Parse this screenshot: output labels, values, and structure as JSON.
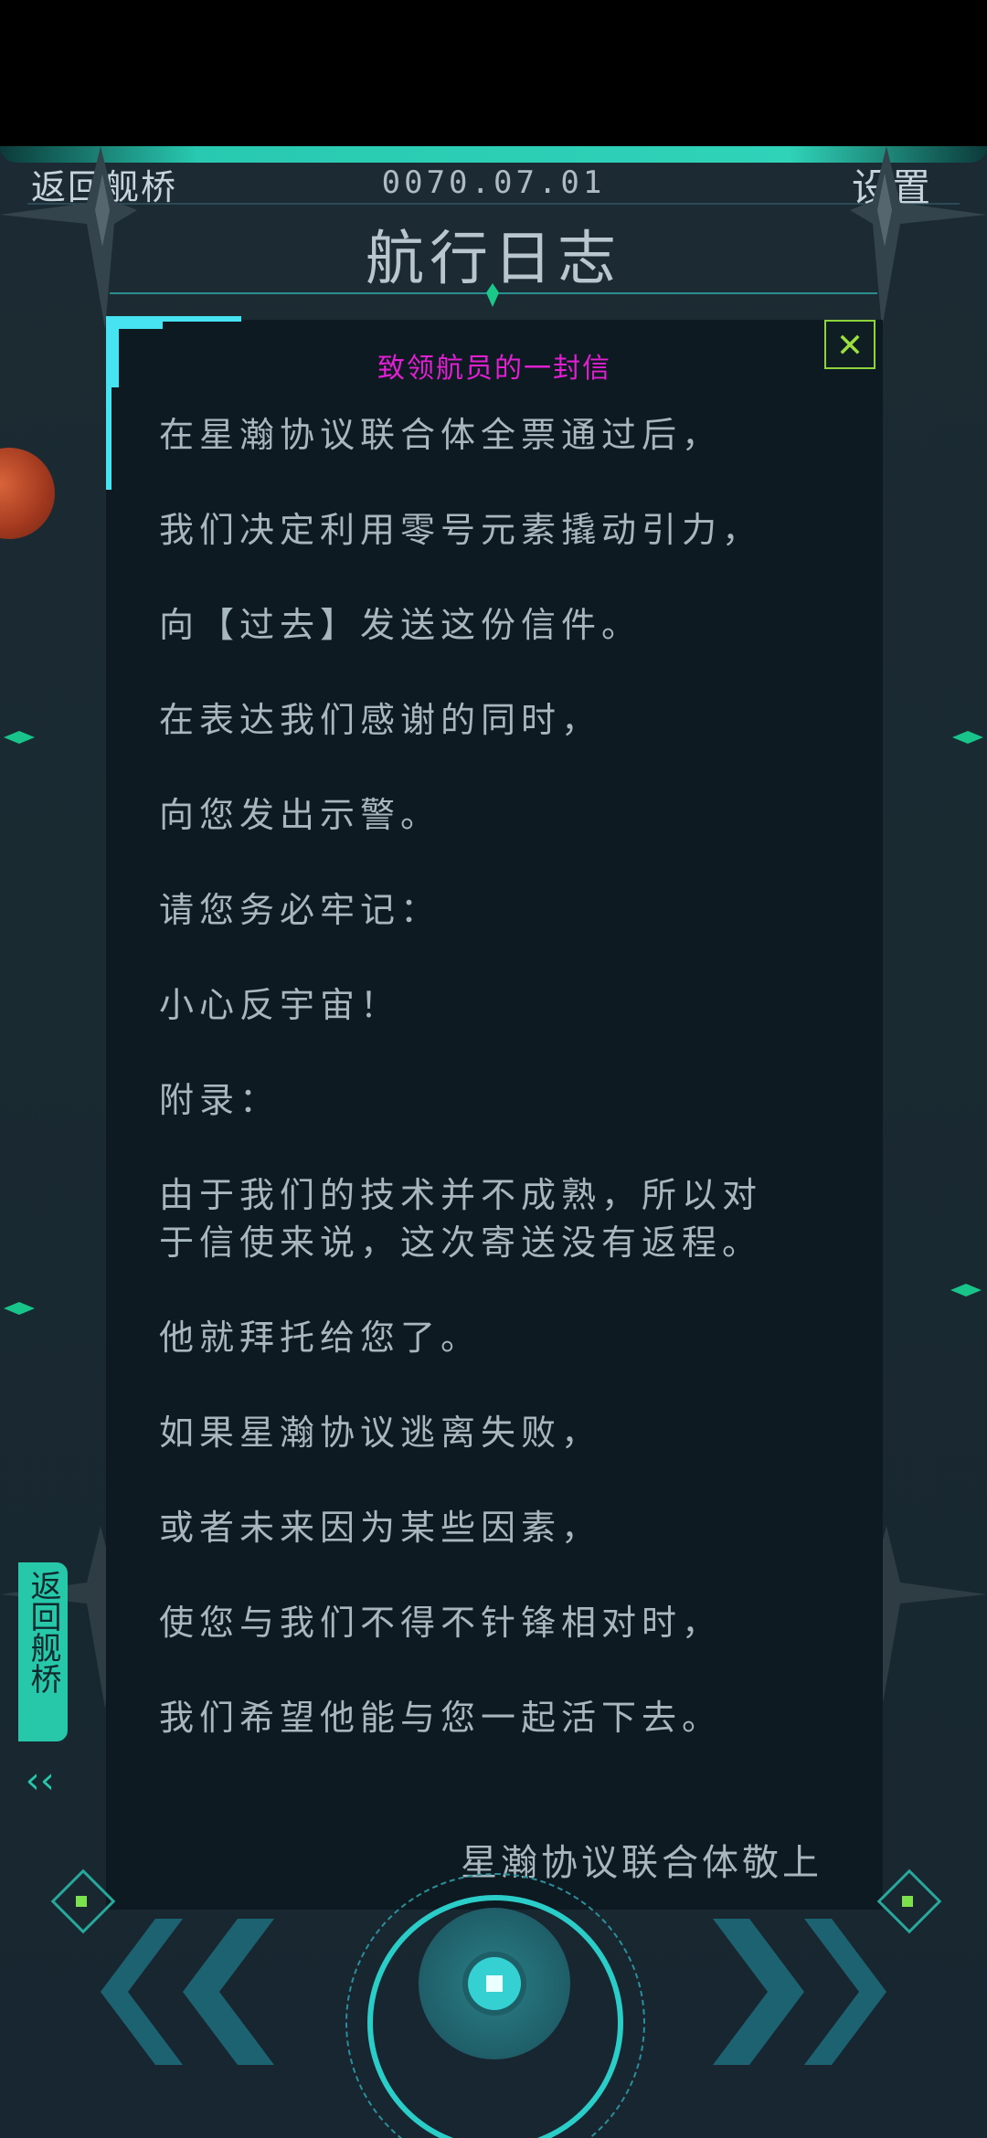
{
  "header": {
    "back_label": "返回舰桥",
    "date": "0070.07.01",
    "settings_label": "设置",
    "title": "航行日志"
  },
  "letter": {
    "title": "致领航员的一封信",
    "close_label": "✕",
    "lines": [
      "在星瀚协议联合体全票通过后，",
      "我们决定利用零号元素撬动引力，",
      "向【过去】发送这份信件。",
      "在表达我们感谢的同时，",
      "向您发出示警。",
      "请您务必牢记：",
      "小心反宇宙！",
      "附录：",
      "由于我们的技术并不成熟，所以对\n于信使来说，这次寄送没有返程。",
      "他就拜托给您了。",
      "如果星瀚协议逃离失败，",
      "或者未来因为某些因素，",
      "使您与我们不得不针锋相对时，",
      "我们希望他能与您一起活下去。"
    ],
    "signature": "星瀚协议联合体敬上"
  },
  "side_tab": {
    "label": "返回舰桥",
    "arrow": "‹‹"
  },
  "nav": {
    "prev_icon": "chevron-double-left-icon",
    "next_icon": "chevron-double-right-icon",
    "center_icon": "center-core-button"
  },
  "colors": {
    "accent": "#2bcdc9",
    "letter_title": "#e21fd2",
    "close": "#9be03f",
    "text": "#a8b6bd"
  }
}
